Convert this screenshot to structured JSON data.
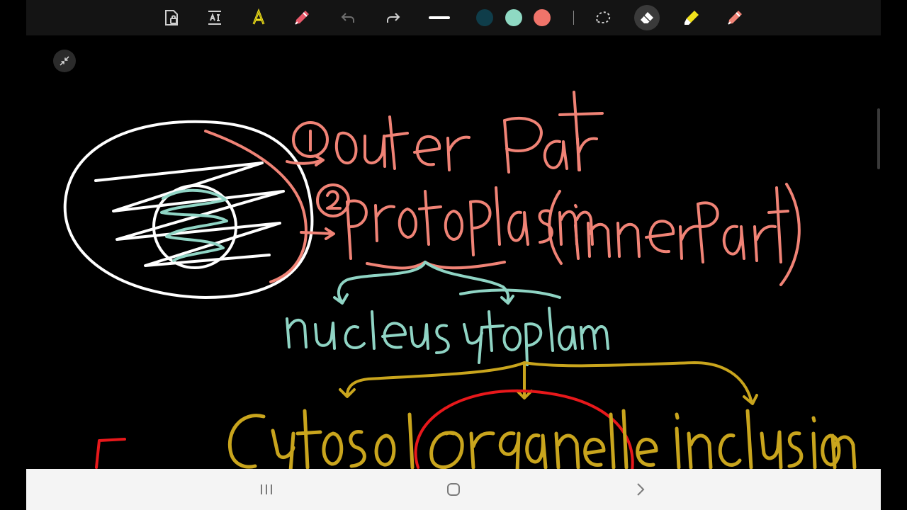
{
  "toolbar": {
    "tools": [
      {
        "name": "lock-text-tool",
        "icon": "lock-document-icon"
      },
      {
        "name": "text-tool",
        "icon": "text-box-icon"
      },
      {
        "name": "font-color-tool",
        "icon": "letter-a-icon"
      },
      {
        "name": "pen-tool",
        "icon": "pen-icon"
      },
      {
        "name": "undo-button",
        "icon": "undo-icon"
      },
      {
        "name": "redo-button",
        "icon": "redo-icon"
      },
      {
        "name": "stroke-width-tool",
        "icon": "line-width-icon"
      },
      {
        "name": "lasso-tool",
        "icon": "lasso-icon"
      },
      {
        "name": "eraser-tool",
        "icon": "eraser-icon",
        "active": true
      },
      {
        "name": "highlighter-tool",
        "icon": "highlighter-icon"
      },
      {
        "name": "pencil-tool",
        "icon": "pencil-icon"
      }
    ],
    "colors": [
      "#0f3d4a",
      "#8fd9c3",
      "#f0746a"
    ],
    "highlighter_color": "#f2e21b",
    "accent_red": "#e8596a"
  },
  "note": {
    "ink_colors": {
      "white": "#ffffff",
      "coral": "#f08376",
      "mint": "#8fd4c4",
      "gold": "#c9a51d",
      "red": "#e8181b"
    }
  },
  "navbar": {
    "buttons": [
      {
        "name": "recent-apps-button",
        "icon": "recent-apps-icon"
      },
      {
        "name": "home-button",
        "icon": "home-icon"
      },
      {
        "name": "back-button",
        "icon": "back-chevron-icon"
      }
    ]
  }
}
